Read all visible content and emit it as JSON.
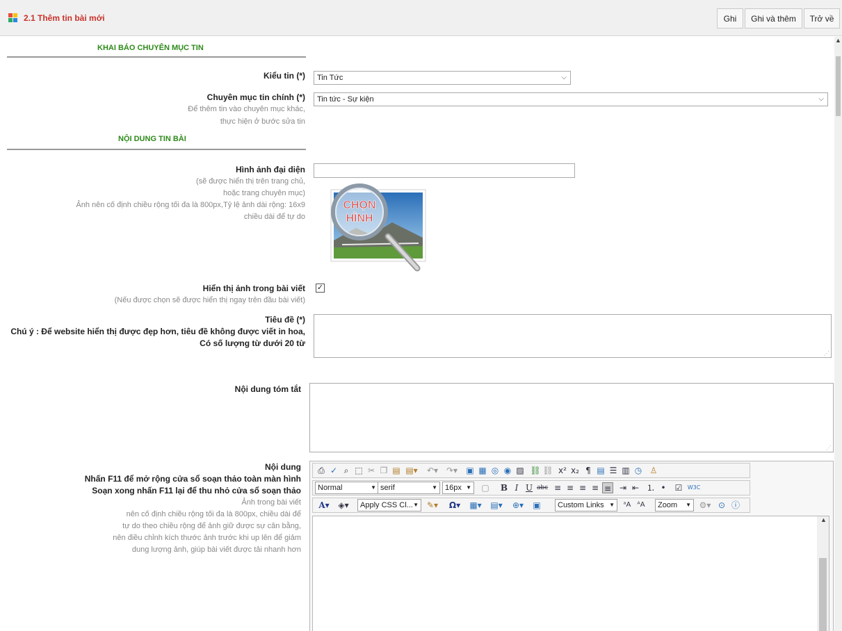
{
  "header": {
    "title": "2.1 Thêm tin bài mới",
    "buttons": {
      "save": "Ghi",
      "save_add": "Ghi và thêm",
      "back": "Trở về"
    }
  },
  "sections": {
    "category": "KHAI BÁO CHUYÊN MỤC TIN",
    "content": "NỘI DUNG TIN BÀI"
  },
  "form": {
    "news_type": {
      "label": "Kiểu tin (*)",
      "value": "Tin Tức"
    },
    "main_category": {
      "label": "Chuyên mục tin chính (*)",
      "hint_1": "Để thêm tin vào chuyên mục khác,",
      "hint_2": "thực hiện ở bước sửa tin",
      "value": "Tin tức - Sự kiện"
    },
    "thumbnail": {
      "label": "Hình ảnh đại diện",
      "hint_1": "(sẽ được hiển thị trên trang chủ,",
      "hint_2": "hoặc trang chuyên mục)",
      "hint_3": "Ảnh nên cố định chiều rộng tối đa là 800px,Tỷ lệ ảnh dài rộng: 16x9",
      "hint_4": "chiều dài để tự do",
      "value": "",
      "image_text_1": "CHỌN",
      "image_text_2": "HÌNH"
    },
    "show_image": {
      "label": "Hiển thị ảnh trong bài viết",
      "hint": "(Nếu được chọn sẽ được hiển thị ngay trên đầu bài viết)",
      "checked": true
    },
    "title": {
      "label": "Tiêu đề (*)",
      "note_1": "Chú ý : Để website hiển thị được đẹp hơn, tiêu đề không được viết in hoa,",
      "note_2": "Có số lượng từ dưới 20 từ",
      "value": ""
    },
    "summary": {
      "label": "Nội dung tóm tắt",
      "value": ""
    },
    "body": {
      "label": "Nội dung",
      "note_1": "Nhấn F11 để mở rộng cửa sổ soạn thảo toàn màn hình",
      "note_2": "Soạn xong nhấn F11 lại để thu nhỏ cửa sổ soạn thảo",
      "hint_1": "Ảnh trong bài viết",
      "hint_2": "nên cố định chiều rộng tối đa là 800px, chiều dài để",
      "hint_3": "tự do theo chiều rộng để ảnh giữ được sự cân bằng,",
      "hint_4": "nên điều chỉnh kích thước ảnh trước khi up lên để giảm",
      "hint_5": "dung lượng ảnh, giúp bài viết được tải nhanh hơn"
    }
  },
  "editor": {
    "format_value": "Normal",
    "font_value": "serif",
    "size_value": "16px",
    "css_class_value": "Apply CSS Cl...",
    "links_value": "Custom Links",
    "zoom_value": "Zoom",
    "content": ""
  },
  "colors": {
    "title_red": "#c8322a",
    "section_green": "#2d8a1a"
  }
}
